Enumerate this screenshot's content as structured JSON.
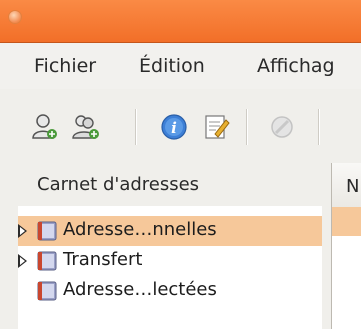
{
  "menubar": {
    "items": [
      {
        "label": "Fichier"
      },
      {
        "label": "Édition"
      },
      {
        "label": "Affichag"
      }
    ]
  },
  "toolbar": {
    "icons": [
      "new-contact-icon",
      "new-list-icon",
      "properties-icon",
      "write-icon",
      "stop-icon"
    ]
  },
  "sidebar": {
    "title": "Carnet d'adresses",
    "items": [
      {
        "label": "Adresse…nnelles",
        "expandable": true,
        "selected": true
      },
      {
        "label": "Transfert",
        "expandable": true,
        "selected": false
      },
      {
        "label": "Adresse…lectées",
        "expandable": false,
        "selected": false
      }
    ]
  },
  "content": {
    "column_header": "N"
  },
  "colors": {
    "titlebar": "#f26f28",
    "selection": "#f6c89a"
  }
}
